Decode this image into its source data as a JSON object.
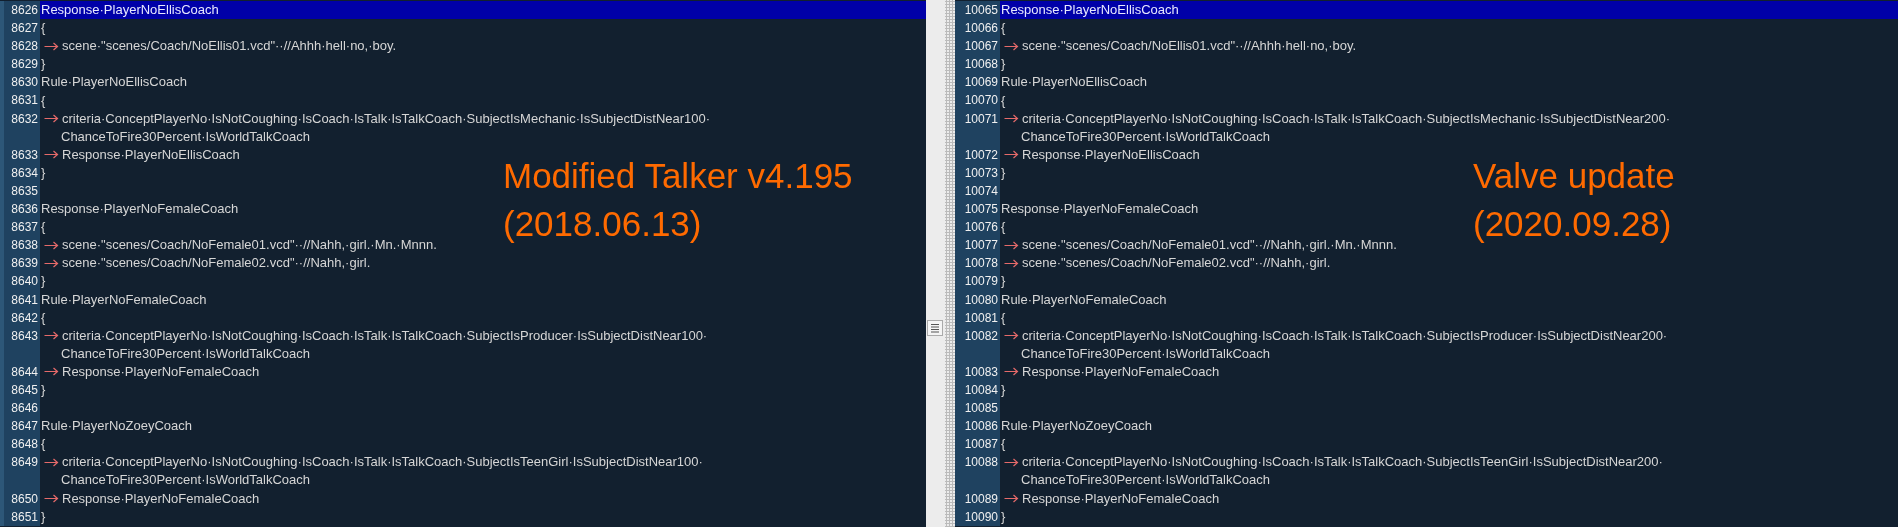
{
  "panes": [
    {
      "annotation": {
        "title": "Modified Talker v4.195",
        "date": "(2018.06.13)"
      },
      "lines": [
        {
          "number": "8626",
          "text": "Response·PlayerNoEllisCoach",
          "tab": false,
          "selected": true
        },
        {
          "number": "8627",
          "text": "{",
          "tab": false,
          "selected": false
        },
        {
          "number": "8628",
          "text": "scene·\"scenes/Coach/NoEllis01.vcd\"··//Ahhh·hell·no,·boy.",
          "tab": true,
          "selected": false
        },
        {
          "number": "8629",
          "text": "}",
          "tab": false,
          "selected": false
        },
        {
          "number": "8630",
          "text": "Rule·PlayerNoEllisCoach",
          "tab": false,
          "selected": false
        },
        {
          "number": "8631",
          "text": "{",
          "tab": false,
          "selected": false
        },
        {
          "number": "8632",
          "text": "criteria·ConceptPlayerNo·IsNotCoughing·IsCoach·IsTalk·IsTalkCoach·SubjectIsMechanic·IsSubjectDistNear100·",
          "continuation": "ChanceToFire30Percent·IsWorldTalkCoach",
          "tab": true,
          "selected": false
        },
        {
          "number": "8633",
          "text": "Response·PlayerNoEllisCoach",
          "tab": true,
          "selected": false
        },
        {
          "number": "8634",
          "text": "}",
          "tab": false,
          "selected": false
        },
        {
          "number": "8635",
          "tab": false,
          "selected": false
        },
        {
          "number": "8636",
          "text": "Response·PlayerNoFemaleCoach",
          "tab": false,
          "selected": false
        },
        {
          "number": "8637",
          "text": "{",
          "tab": false,
          "selected": false
        },
        {
          "number": "8638",
          "text": "scene·\"scenes/Coach/NoFemale01.vcd\"··//Nahh,·girl.·Mn.·Mnnn.",
          "tab": true,
          "selected": false
        },
        {
          "number": "8639",
          "text": "scene·\"scenes/Coach/NoFemale02.vcd\"··//Nahh,·girl.",
          "tab": true,
          "selected": false
        },
        {
          "number": "8640",
          "text": "}",
          "tab": false,
          "selected": false
        },
        {
          "number": "8641",
          "text": "Rule·PlayerNoFemaleCoach",
          "tab": false,
          "selected": false
        },
        {
          "number": "8642",
          "text": "{",
          "tab": false,
          "selected": false
        },
        {
          "number": "8643",
          "text": "criteria·ConceptPlayerNo·IsNotCoughing·IsCoach·IsTalk·IsTalkCoach·SubjectIsProducer·IsSubjectDistNear100·",
          "continuation": "ChanceToFire30Percent·IsWorldTalkCoach",
          "tab": true,
          "selected": false
        },
        {
          "number": "8644",
          "text": "Response·PlayerNoFemaleCoach",
          "tab": true,
          "selected": false
        },
        {
          "number": "8645",
          "text": "}",
          "tab": false,
          "selected": false
        },
        {
          "number": "8646",
          "tab": false,
          "selected": false
        },
        {
          "number": "8647",
          "text": "Rule·PlayerNoZoeyCoach",
          "tab": false,
          "selected": false
        },
        {
          "number": "8648",
          "text": "{",
          "tab": false,
          "selected": false
        },
        {
          "number": "8649",
          "text": "criteria·ConceptPlayerNo·IsNotCoughing·IsCoach·IsTalk·IsTalkCoach·SubjectIsTeenGirl·IsSubjectDistNear100·",
          "continuation": "ChanceToFire30Percent·IsWorldTalkCoach",
          "tab": true,
          "selected": false
        },
        {
          "number": "8650",
          "text": "Response·PlayerNoFemaleCoach",
          "tab": true,
          "selected": false
        },
        {
          "number": "8651",
          "text": "}",
          "tab": false,
          "selected": false
        }
      ]
    },
    {
      "annotation": {
        "title": "Valve update",
        "date": "(2020.09.28)"
      },
      "lines": [
        {
          "number": "10065",
          "text": "Response·PlayerNoEllisCoach",
          "tab": false,
          "selected": true
        },
        {
          "number": "10066",
          "text": "{",
          "tab": false,
          "selected": false
        },
        {
          "number": "10067",
          "text": "scene·\"scenes/Coach/NoEllis01.vcd\"··//Ahhh·hell·no,·boy.",
          "tab": true,
          "selected": false
        },
        {
          "number": "10068",
          "text": "}",
          "tab": false,
          "selected": false
        },
        {
          "number": "10069",
          "text": "Rule·PlayerNoEllisCoach",
          "tab": false,
          "selected": false
        },
        {
          "number": "10070",
          "text": "{",
          "tab": false,
          "selected": false
        },
        {
          "number": "10071",
          "text": "criteria·ConceptPlayerNo·IsNotCoughing·IsCoach·IsTalk·IsTalkCoach·SubjectIsMechanic·IsSubjectDistNear200·",
          "continuation": "ChanceToFire30Percent·IsWorldTalkCoach",
          "tab": true,
          "selected": false
        },
        {
          "number": "10072",
          "text": "Response·PlayerNoEllisCoach",
          "tab": true,
          "selected": false
        },
        {
          "number": "10073",
          "text": "}",
          "tab": false,
          "selected": false
        },
        {
          "number": "10074",
          "tab": false,
          "selected": false
        },
        {
          "number": "10075",
          "text": "Response·PlayerNoFemaleCoach",
          "tab": false,
          "selected": false
        },
        {
          "number": "10076",
          "text": "{",
          "tab": false,
          "selected": false
        },
        {
          "number": "10077",
          "text": "scene·\"scenes/Coach/NoFemale01.vcd\"··//Nahh,·girl.·Mn.·Mnnn.",
          "tab": true,
          "selected": false
        },
        {
          "number": "10078",
          "text": "scene·\"scenes/Coach/NoFemale02.vcd\"··//Nahh,·girl.",
          "tab": true,
          "selected": false
        },
        {
          "number": "10079",
          "text": "}",
          "tab": false,
          "selected": false
        },
        {
          "number": "10080",
          "text": "Rule·PlayerNoFemaleCoach",
          "tab": false,
          "selected": false
        },
        {
          "number": "10081",
          "text": "{",
          "tab": false,
          "selected": false
        },
        {
          "number": "10082",
          "text": "criteria·ConceptPlayerNo·IsNotCoughing·IsCoach·IsTalk·IsTalkCoach·SubjectIsProducer·IsSubjectDistNear200·",
          "continuation": "ChanceToFire30Percent·IsWorldTalkCoach",
          "tab": true,
          "selected": false
        },
        {
          "number": "10083",
          "text": "Response·PlayerNoFemaleCoach",
          "tab": true,
          "selected": false
        },
        {
          "number": "10084",
          "text": "}",
          "tab": false,
          "selected": false
        },
        {
          "number": "10085",
          "tab": false,
          "selected": false
        },
        {
          "number": "10086",
          "text": "Rule·PlayerNoZoeyCoach",
          "tab": false,
          "selected": false
        },
        {
          "number": "10087",
          "text": "{",
          "tab": false,
          "selected": false
        },
        {
          "number": "10088",
          "text": "criteria·ConceptPlayerNo·IsNotCoughing·IsCoach·IsTalk·IsTalkCoach·SubjectIsTeenGirl·IsSubjectDistNear200·",
          "continuation": "ChanceToFire30Percent·IsWorldTalkCoach",
          "tab": true,
          "selected": false
        },
        {
          "number": "10089",
          "text": "Response·PlayerNoFemaleCoach",
          "tab": true,
          "selected": false
        },
        {
          "number": "10090",
          "text": "}",
          "tab": false,
          "selected": false
        }
      ]
    }
  ]
}
